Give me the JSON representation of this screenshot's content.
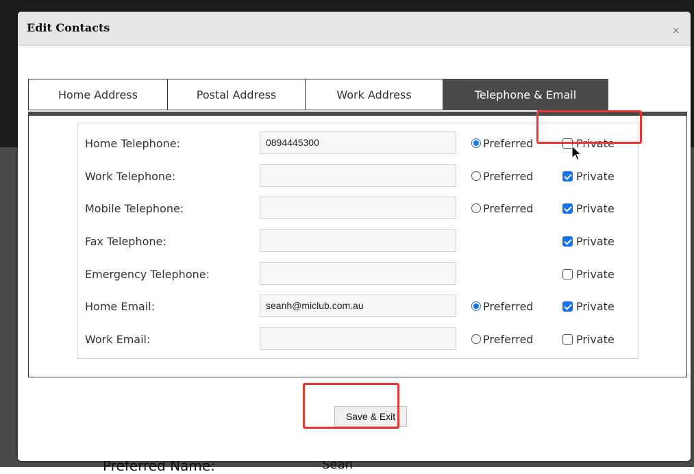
{
  "modal": {
    "title": "Edit Contacts",
    "close_label": "×"
  },
  "tabs": [
    {
      "label": "Home Address",
      "active": false
    },
    {
      "label": "Postal Address",
      "active": false
    },
    {
      "label": "Work Address",
      "active": false
    },
    {
      "label": "Telephone & Email",
      "active": true
    }
  ],
  "rows": [
    {
      "label": "Home Telephone:",
      "value": "0894445300",
      "preferred": true,
      "has_preferred": true,
      "private": false
    },
    {
      "label": "Work Telephone:",
      "value": "",
      "preferred": false,
      "has_preferred": true,
      "private": true
    },
    {
      "label": "Mobile Telephone:",
      "value": "",
      "preferred": false,
      "has_preferred": true,
      "private": true
    },
    {
      "label": "Fax Telephone:",
      "value": "",
      "preferred": false,
      "has_preferred": false,
      "private": true
    },
    {
      "label": "Emergency Telephone:",
      "value": "",
      "preferred": false,
      "has_preferred": false,
      "private": false
    },
    {
      "label": "Home Email:",
      "value": "seanh@miclub.com.au",
      "preferred": true,
      "has_preferred": true,
      "private": true
    },
    {
      "label": "Work Email:",
      "value": "",
      "preferred": false,
      "has_preferred": true,
      "private": false
    }
  ],
  "option_labels": {
    "preferred": "Preferred",
    "private": "Private"
  },
  "actions": {
    "save_label": "Save & Exit"
  },
  "background": {
    "fragment_left": "Preferred Name:",
    "fragment_right": "Sean"
  },
  "colors": {
    "accent": "#1a73e8",
    "highlight": "#e53935",
    "active_tab": "#4a4a4a"
  }
}
